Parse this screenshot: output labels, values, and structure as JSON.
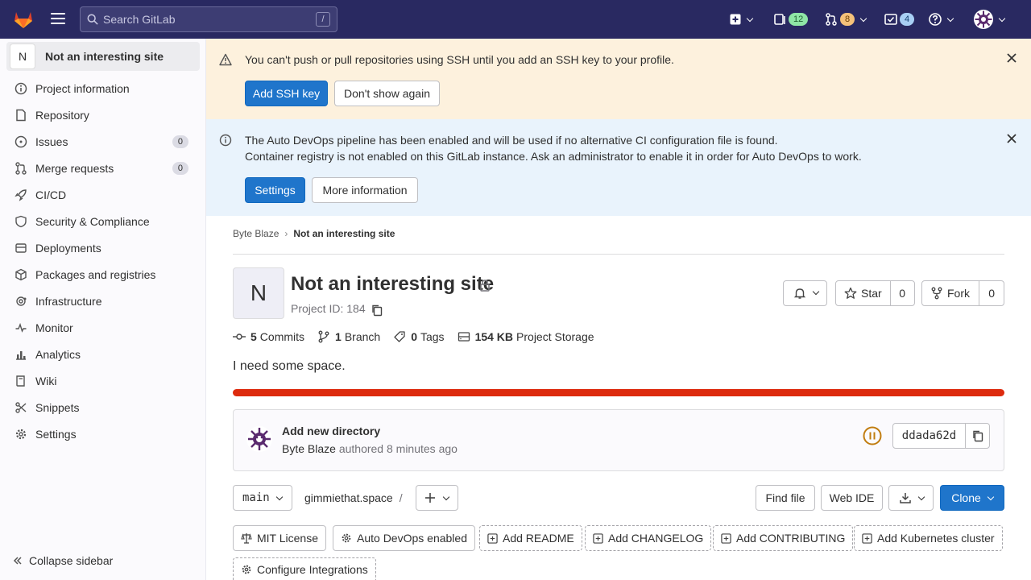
{
  "topbar": {
    "search_placeholder": "Search GitLab",
    "search_shortcut": "/",
    "issues_count": "12",
    "mr_count": "8",
    "todos_count": "4"
  },
  "sidebar": {
    "project_avatar_letter": "N",
    "project_name": "Not an interesting site",
    "items": [
      {
        "label": "Project information",
        "icon": "info-icon"
      },
      {
        "label": "Repository",
        "icon": "document-icon"
      },
      {
        "label": "Issues",
        "icon": "issues-icon",
        "count": "0"
      },
      {
        "label": "Merge requests",
        "icon": "merge-request-icon",
        "count": "0"
      },
      {
        "label": "CI/CD",
        "icon": "rocket-icon"
      },
      {
        "label": "Security & Compliance",
        "icon": "shield-icon"
      },
      {
        "label": "Deployments",
        "icon": "deployments-icon"
      },
      {
        "label": "Packages and registries",
        "icon": "package-icon"
      },
      {
        "label": "Infrastructure",
        "icon": "cloud-gear-icon"
      },
      {
        "label": "Monitor",
        "icon": "monitor-icon"
      },
      {
        "label": "Analytics",
        "icon": "chart-icon"
      },
      {
        "label": "Wiki",
        "icon": "book-icon"
      },
      {
        "label": "Snippets",
        "icon": "snippet-icon"
      },
      {
        "label": "Settings",
        "icon": "gear-icon"
      }
    ],
    "collapse_label": "Collapse sidebar"
  },
  "ssh_banner": {
    "message": "You can't push or pull repositories using SSH until you add an SSH key to your profile.",
    "primary": "Add SSH key",
    "secondary": "Don't show again"
  },
  "devops_banner": {
    "line1": "The Auto DevOps pipeline has been enabled and will be used if no alternative CI configuration file is found.",
    "line2": "Container registry is not enabled on this GitLab instance. Ask an administrator to enable it in order for Auto DevOps to work.",
    "primary": "Settings",
    "secondary": "More information"
  },
  "breadcrumb": {
    "parent": "Byte Blaze",
    "current": "Not an interesting site"
  },
  "project": {
    "avatar_letter": "N",
    "title": "Not an interesting site",
    "id_label": "Project ID: 184",
    "description": "I need some space.",
    "star_label": "Star",
    "star_count": "0",
    "fork_label": "Fork",
    "fork_count": "0",
    "stats": {
      "commits_num": "5",
      "commits_label": "Commits",
      "branches_num": "1",
      "branches_label": "Branch",
      "tags_num": "0",
      "tags_label": "Tags",
      "storage_num": "154 KB",
      "storage_label": "Project Storage"
    },
    "storage_bar_color": "#dd2b0e"
  },
  "commit": {
    "title": "Add new directory",
    "author": "Byte Blaze",
    "meta": "authored 8 minutes ago",
    "sha": "ddada62d"
  },
  "repo_toolbar": {
    "branch": "main",
    "path": "gimmiethat.space",
    "path_sep": "/",
    "find_file": "Find file",
    "web_ide": "Web IDE",
    "clone": "Clone"
  },
  "quick_links": {
    "license": "MIT License",
    "autodevops": "Auto DevOps enabled",
    "readme": "Add README",
    "changelog": "Add CHANGELOG",
    "contributing": "Add CONTRIBUTING",
    "kubernetes": "Add Kubernetes cluster",
    "integrations": "Configure Integrations"
  }
}
